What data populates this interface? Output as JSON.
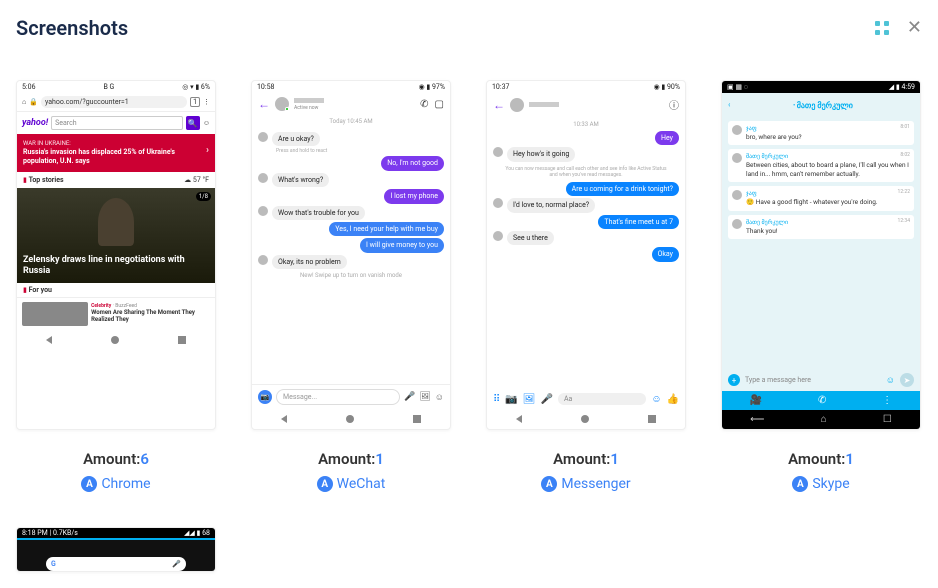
{
  "header": {
    "title": "Screenshots"
  },
  "cards": [
    {
      "amount_label": "Amount",
      "amount_value": "6",
      "app_icon_letter": "A",
      "app_name": "Chrome",
      "chrome": {
        "status_left": "5:06",
        "status_icons": "B  G",
        "status_right": "◎ ▾ ▮ 6%",
        "url": "yahoo.com/?guccounter=1",
        "tab_count": "1",
        "yahoo_logo": "yahoo!",
        "search_placeholder": "Search",
        "war_kicker": "WAR IN UKRAINE:",
        "war_headline": "Russia's invasion has displaced 25% of Ukraine's population, U.N. says",
        "top_stories_label": "Top stories",
        "weather": "☁ 57 °F",
        "hero_count": "1/8",
        "hero_headline": "Zelensky draws line in negotiations with Russia",
        "for_you_label": "For you",
        "celeb_category": "Celebrity",
        "celeb_source": "BuzzFeed",
        "celeb_headline": "Women Are Sharing The Moment They Realized They"
      }
    },
    {
      "amount_label": "Amount",
      "amount_value": "1",
      "app_icon_letter": "A",
      "app_name": "WeChat",
      "chat": {
        "status_time": "10:58",
        "status_batt": "◉ ▮ 97%",
        "active_label": "Active now",
        "conv_time": "Today 10:45 AM",
        "m1": "Are u okay?",
        "hint": "Press and hold to react",
        "r1": "No, I'm not good",
        "m2": "What's wrong?",
        "r2": "I lost my phone",
        "m3": "Wow that's trouble for you",
        "r3": "Yes, I need your help with me buy",
        "r4": "I will give money to you",
        "m4": "Okay, its no problem",
        "vanish_hint": "New! Swipe up to turn on vanish mode",
        "compose": "Message..."
      }
    },
    {
      "amount_label": "Amount",
      "amount_value": "1",
      "app_icon_letter": "A",
      "app_name": "Messenger",
      "chat": {
        "status_time": "10:37",
        "status_batt": "◉ ▮ 90%",
        "conv_time": "10:33 AM",
        "r1": "Hey",
        "m1": "Hey how's it going",
        "sys": "You can now message and call each other and see info like Active Status and when you've read messages.",
        "r2": "Are u coming for a drink tonight?",
        "m2": "I'd love to, normal place?",
        "r3": "That's fine meet u at 7",
        "m3": "See u there",
        "r4": "Okay",
        "compose": "Aa"
      }
    },
    {
      "amount_label": "Amount",
      "amount_value": "1",
      "app_icon_letter": "A",
      "app_name": "Skype",
      "skype": {
        "status_left": "▣ ▦ ◌",
        "status_right": "◢ ▮ 4:59",
        "contact": "᠂ მათე მერკული",
        "msgs": [
          {
            "who": "ჯაფ",
            "time": "8:01",
            "text": "bro, where are you?"
          },
          {
            "who": "მათე მერკული",
            "time": "8:02",
            "text": "Between cities, about to board a plane, I'll call you when I land in... hmm, can't remember actually."
          },
          {
            "who": "ჯაფ",
            "time": "12:22",
            "text": "🙂 Have a good flight - whatever you're doing."
          },
          {
            "who": "მათე მერკული",
            "time": "12:34",
            "text": "Thank you!"
          }
        ],
        "input_placeholder": "Type a message here"
      }
    }
  ],
  "partial": {
    "status_left": "8:18 PM | 0.7KB/s",
    "status_right": "◢◢ ▮ 68"
  }
}
